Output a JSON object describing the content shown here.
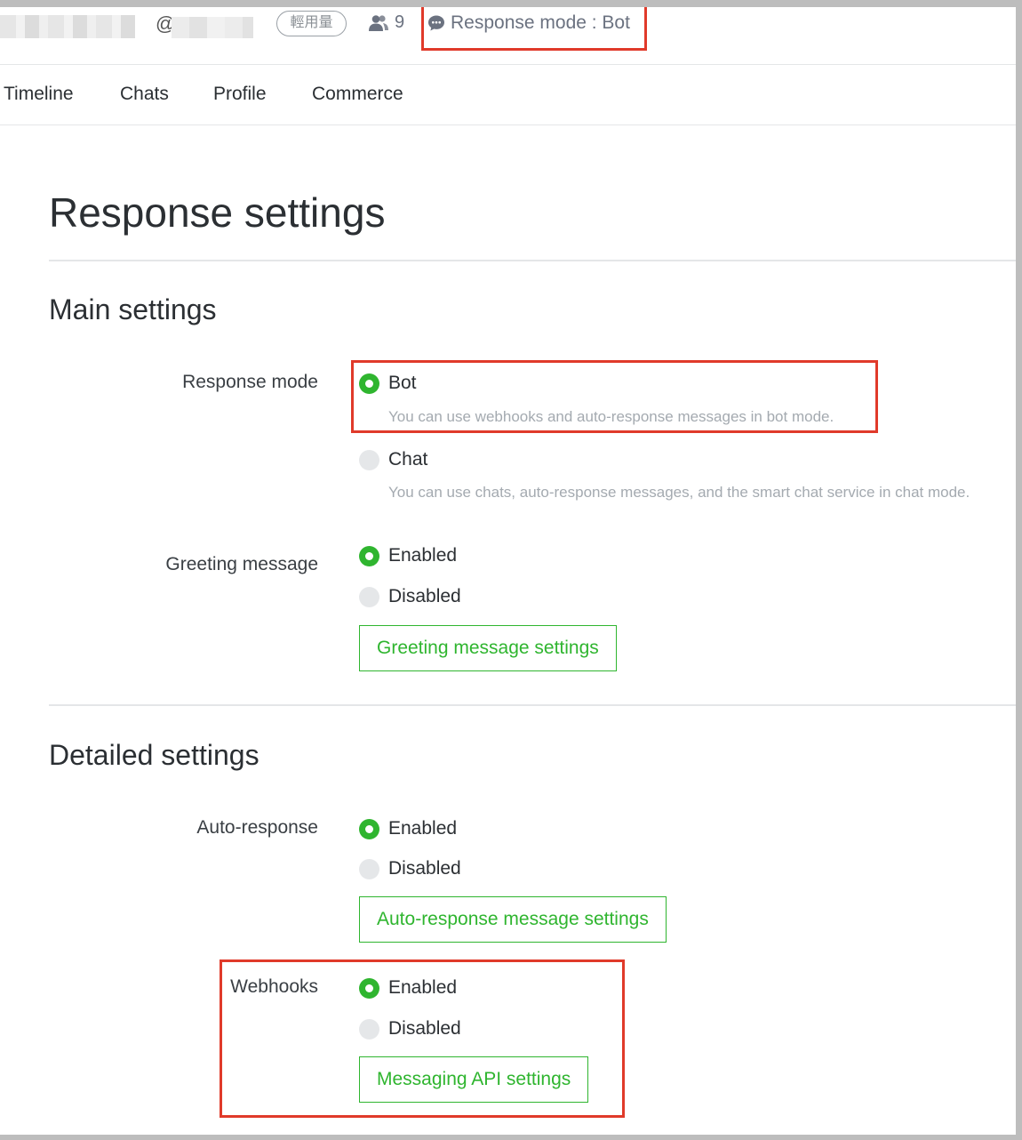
{
  "header": {
    "at_symbol": "@",
    "badge": "輕用量",
    "friends_count": "9",
    "friends_icon": "people-icon",
    "response_mode_icon": "chat-bubble-icon",
    "response_mode_text": "Response mode : Bot"
  },
  "nav": {
    "tabs": [
      {
        "label": "Timeline"
      },
      {
        "label": "Chats"
      },
      {
        "label": "Profile"
      },
      {
        "label": "Commerce"
      }
    ]
  },
  "page_title": "Response settings",
  "main_settings": {
    "heading": "Main settings",
    "response_mode": {
      "label": "Response mode",
      "options": [
        {
          "label": "Bot",
          "description": "You can use webhooks and auto-response messages in bot mode.",
          "selected": true
        },
        {
          "label": "Chat",
          "description": "You can use chats, auto-response messages, and the smart chat service in chat mode.",
          "selected": false
        }
      ]
    },
    "greeting_message": {
      "label": "Greeting message",
      "enabled_label": "Enabled",
      "disabled_label": "Disabled",
      "selected": "Enabled",
      "button": "Greeting message settings"
    }
  },
  "detailed_settings": {
    "heading": "Detailed settings",
    "auto_response": {
      "label": "Auto-response",
      "enabled_label": "Enabled",
      "disabled_label": "Disabled",
      "selected": "Enabled",
      "button": "Auto-response message settings"
    },
    "webhooks": {
      "label": "Webhooks",
      "enabled_label": "Enabled",
      "disabled_label": "Disabled",
      "selected": "Enabled",
      "button": "Messaging API settings"
    }
  },
  "colors": {
    "accent_green": "#2fb52f",
    "highlight_red": "#e03a2a",
    "text_dark": "#2b2f33",
    "text_muted": "#a4aab0"
  }
}
